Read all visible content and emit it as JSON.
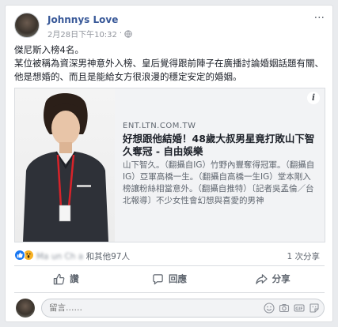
{
  "post": {
    "author": "Johnnys Love",
    "date": "2月28日下午10:32",
    "separator": "·",
    "text_line1": "傑尼斯入榜4名。",
    "text_line2": "某位被稱為資深男神意外入榜、皇后覺得跟前陣子在廣播討論婚姻話題有關、他是想婚的、而且是能給女方很浪漫的穩定安定的婚姻。"
  },
  "link": {
    "domain": "ENT.LTN.COM.TW",
    "title": "好想跟他結婚！48歲大叔男星竟打敗山下智久奪冠 - 自由娛樂",
    "description": "山下智久。（翻攝自IG）竹野內豐奪得冠軍。（翻攝自IG）亞軍高橋一生。（翻攝自高橋一生IG）堂本剛入榜讓粉絲相當意外。（翻攝自推特）〔記者吳孟倫／台北報導〕不少女性會幻想與喜愛的男神",
    "info_icon": "i"
  },
  "reactions": {
    "names_blurred": "Ma un Ch a",
    "others": "和其他97人",
    "shares": "1 次分享"
  },
  "actions": {
    "like": "讚",
    "comment": "回應",
    "share": "分享"
  },
  "comment_box": {
    "placeholder": "留言……"
  },
  "colors": {
    "author_link": "#385898",
    "like_blue": "#1877f2",
    "wow_yellow": "#f7b125"
  }
}
